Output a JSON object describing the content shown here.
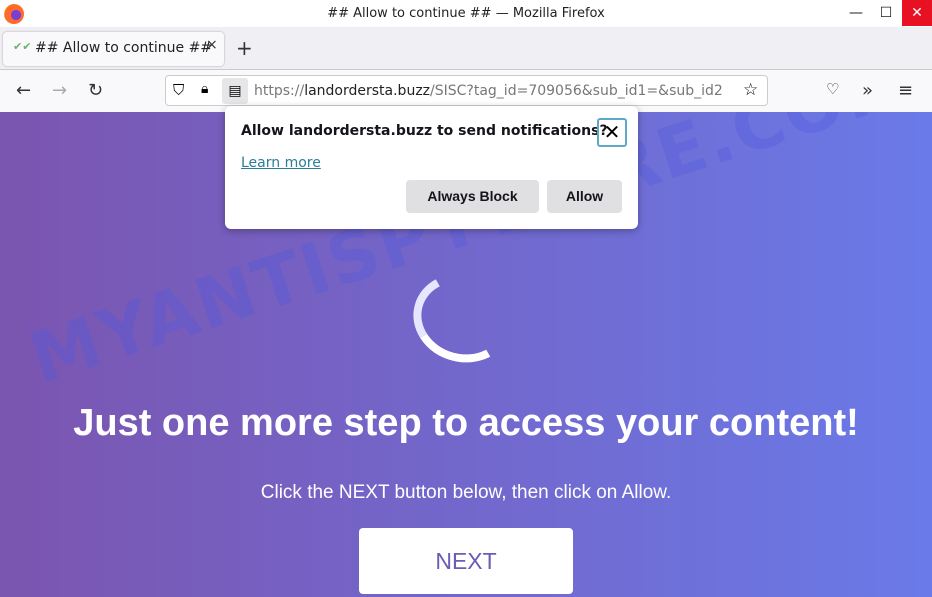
{
  "window": {
    "title": "## Allow to continue ## — Mozilla Firefox",
    "minimize": "—",
    "maximize": "☐",
    "close": "✕"
  },
  "tab": {
    "label": "## Allow to continue ##",
    "close": "×",
    "new_tab": "+"
  },
  "nav": {
    "back": "←",
    "forward": "→",
    "reload": "↻",
    "url_prefix": "https://",
    "url_domain": "landordersta.buzz",
    "url_rest": "/SISC?tag_id=709056&sub_id1=&sub_id2",
    "bookmark": "☆",
    "pocket": "♡",
    "overflow": "»",
    "menu": "≡"
  },
  "popup": {
    "question": "Allow landordersta.buzz to send notifications?",
    "learn_more": "Learn more",
    "always_block": "Always Block",
    "allow": "Allow",
    "close": "✕"
  },
  "page": {
    "heading": "Just one more step to access your content!",
    "subtext": "Click the NEXT button below, then click on Allow.",
    "next_button": "NEXT",
    "watermark": "MYANTISPYWARE.COM"
  },
  "colors": {
    "gradient_start": "#7b55b0",
    "gradient_end": "#6a7ae8",
    "close_red": "#e81123"
  }
}
